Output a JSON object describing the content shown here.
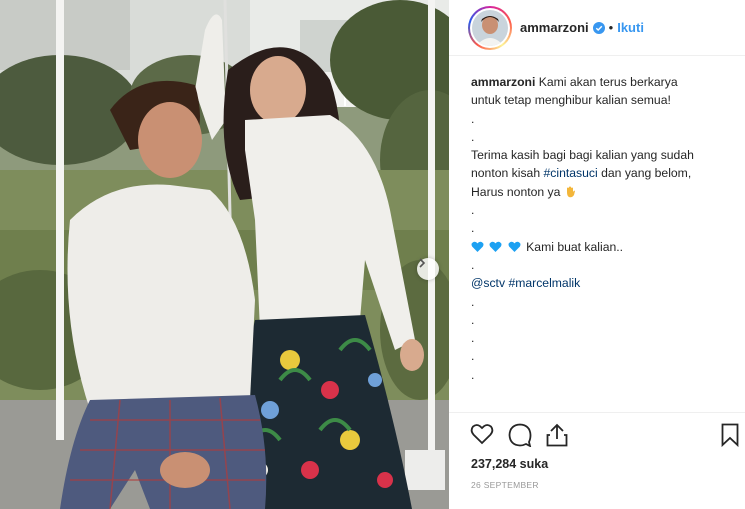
{
  "post": {
    "username": "ammarzoni",
    "follow_label": "Ikuti",
    "separator": "•",
    "caption_lines": [
      "Kami akan terus berkarya",
      "untuk tetap menghibur kalian semua!",
      ".",
      ".",
      "Terima kasih bagi bagi kalian yang sudah",
      "nonton kisah",
      "#cintasuci",
      "dan yang belom,",
      "Harus nonton ya",
      ".",
      ".",
      "Kami buat kalian..",
      ".",
      "@sctv",
      "#marcelmalik",
      ".",
      ".",
      ".",
      ".",
      ".",
      "."
    ],
    "likes": "237,284 suka",
    "date": "26 SEPTEMBER"
  },
  "colors": {
    "accent": "#3897f0",
    "link": "#003569",
    "heart_blue": "#1da1f2",
    "text": "#262626",
    "muted": "#999999"
  },
  "icons": {
    "verified": "verified-badge-icon",
    "like": "heart-outline-icon",
    "comment": "comment-bubble-icon",
    "share": "share-arrow-icon",
    "save": "bookmark-icon",
    "next": "chevron-right-icon"
  }
}
